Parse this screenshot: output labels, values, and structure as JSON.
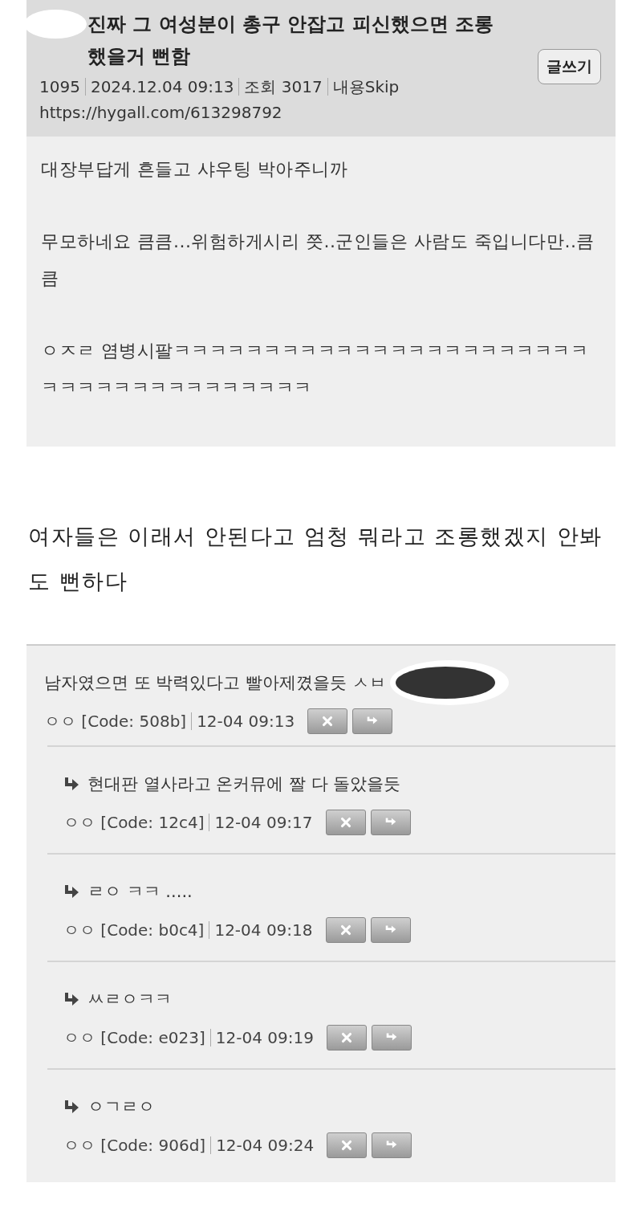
{
  "post": {
    "title": "진짜 그 여성분이 총구 안잡고 피신했으면 조롱했을거 뻔함",
    "write_button": "글쓰기",
    "meta": [
      "1095",
      "2024.12.04 09:13",
      "조회 3017",
      "내용Skip"
    ],
    "url": "https://hygall.com/613298792",
    "excerpt": [
      "대장부답게 흔들고 샤우팅 박아주니까",
      "무모하네요 큼큼...위험하게시리 쯧..군인들은 사람도 죽입니다만..큼큼",
      "ㅇㅈㄹ 염병시팔ㅋㅋㅋㅋㅋㅋㅋㅋㅋㅋㅋㅋㅋㅋㅋㅋㅋㅋㅋㅋㅋㅋㅋㅋㅋㅋㅋㅋㅋㅋㅋㅋㅋㅋㅋㅋㅋㅋ"
    ]
  },
  "body_text": "여자들은 이래서 안된다고 엄청 뭐라고 조롱했겠지 안봐도 뻔하다",
  "comments": [
    {
      "text": "남자였으면 또 박력있다고 빨아제꼈을듯 ㅅㅂ",
      "author": "ㅇㅇ",
      "code": "[Code: 508b]",
      "time": "12-04 09:13",
      "children": [
        {
          "text": "현대판 열사라고 온커뮤에 짤 다 돌았을듯",
          "author": "ㅇㅇ",
          "code": "[Code: 12c4]",
          "time": "12-04 09:17"
        },
        {
          "text": "ㄹㅇ ㅋㅋ .....",
          "author": "ㅇㅇ",
          "code": "[Code: b0c4]",
          "time": "12-04 09:18"
        },
        {
          "text": "ㅆㄹㅇㅋㅋ",
          "author": "ㅇㅇ",
          "code": "[Code: e023]",
          "time": "12-04 09:19"
        },
        {
          "text": "ㅇㄱㄹㅇ",
          "author": "ㅇㅇ",
          "code": "[Code: 906d]",
          "time": "12-04 09:24"
        }
      ]
    }
  ]
}
